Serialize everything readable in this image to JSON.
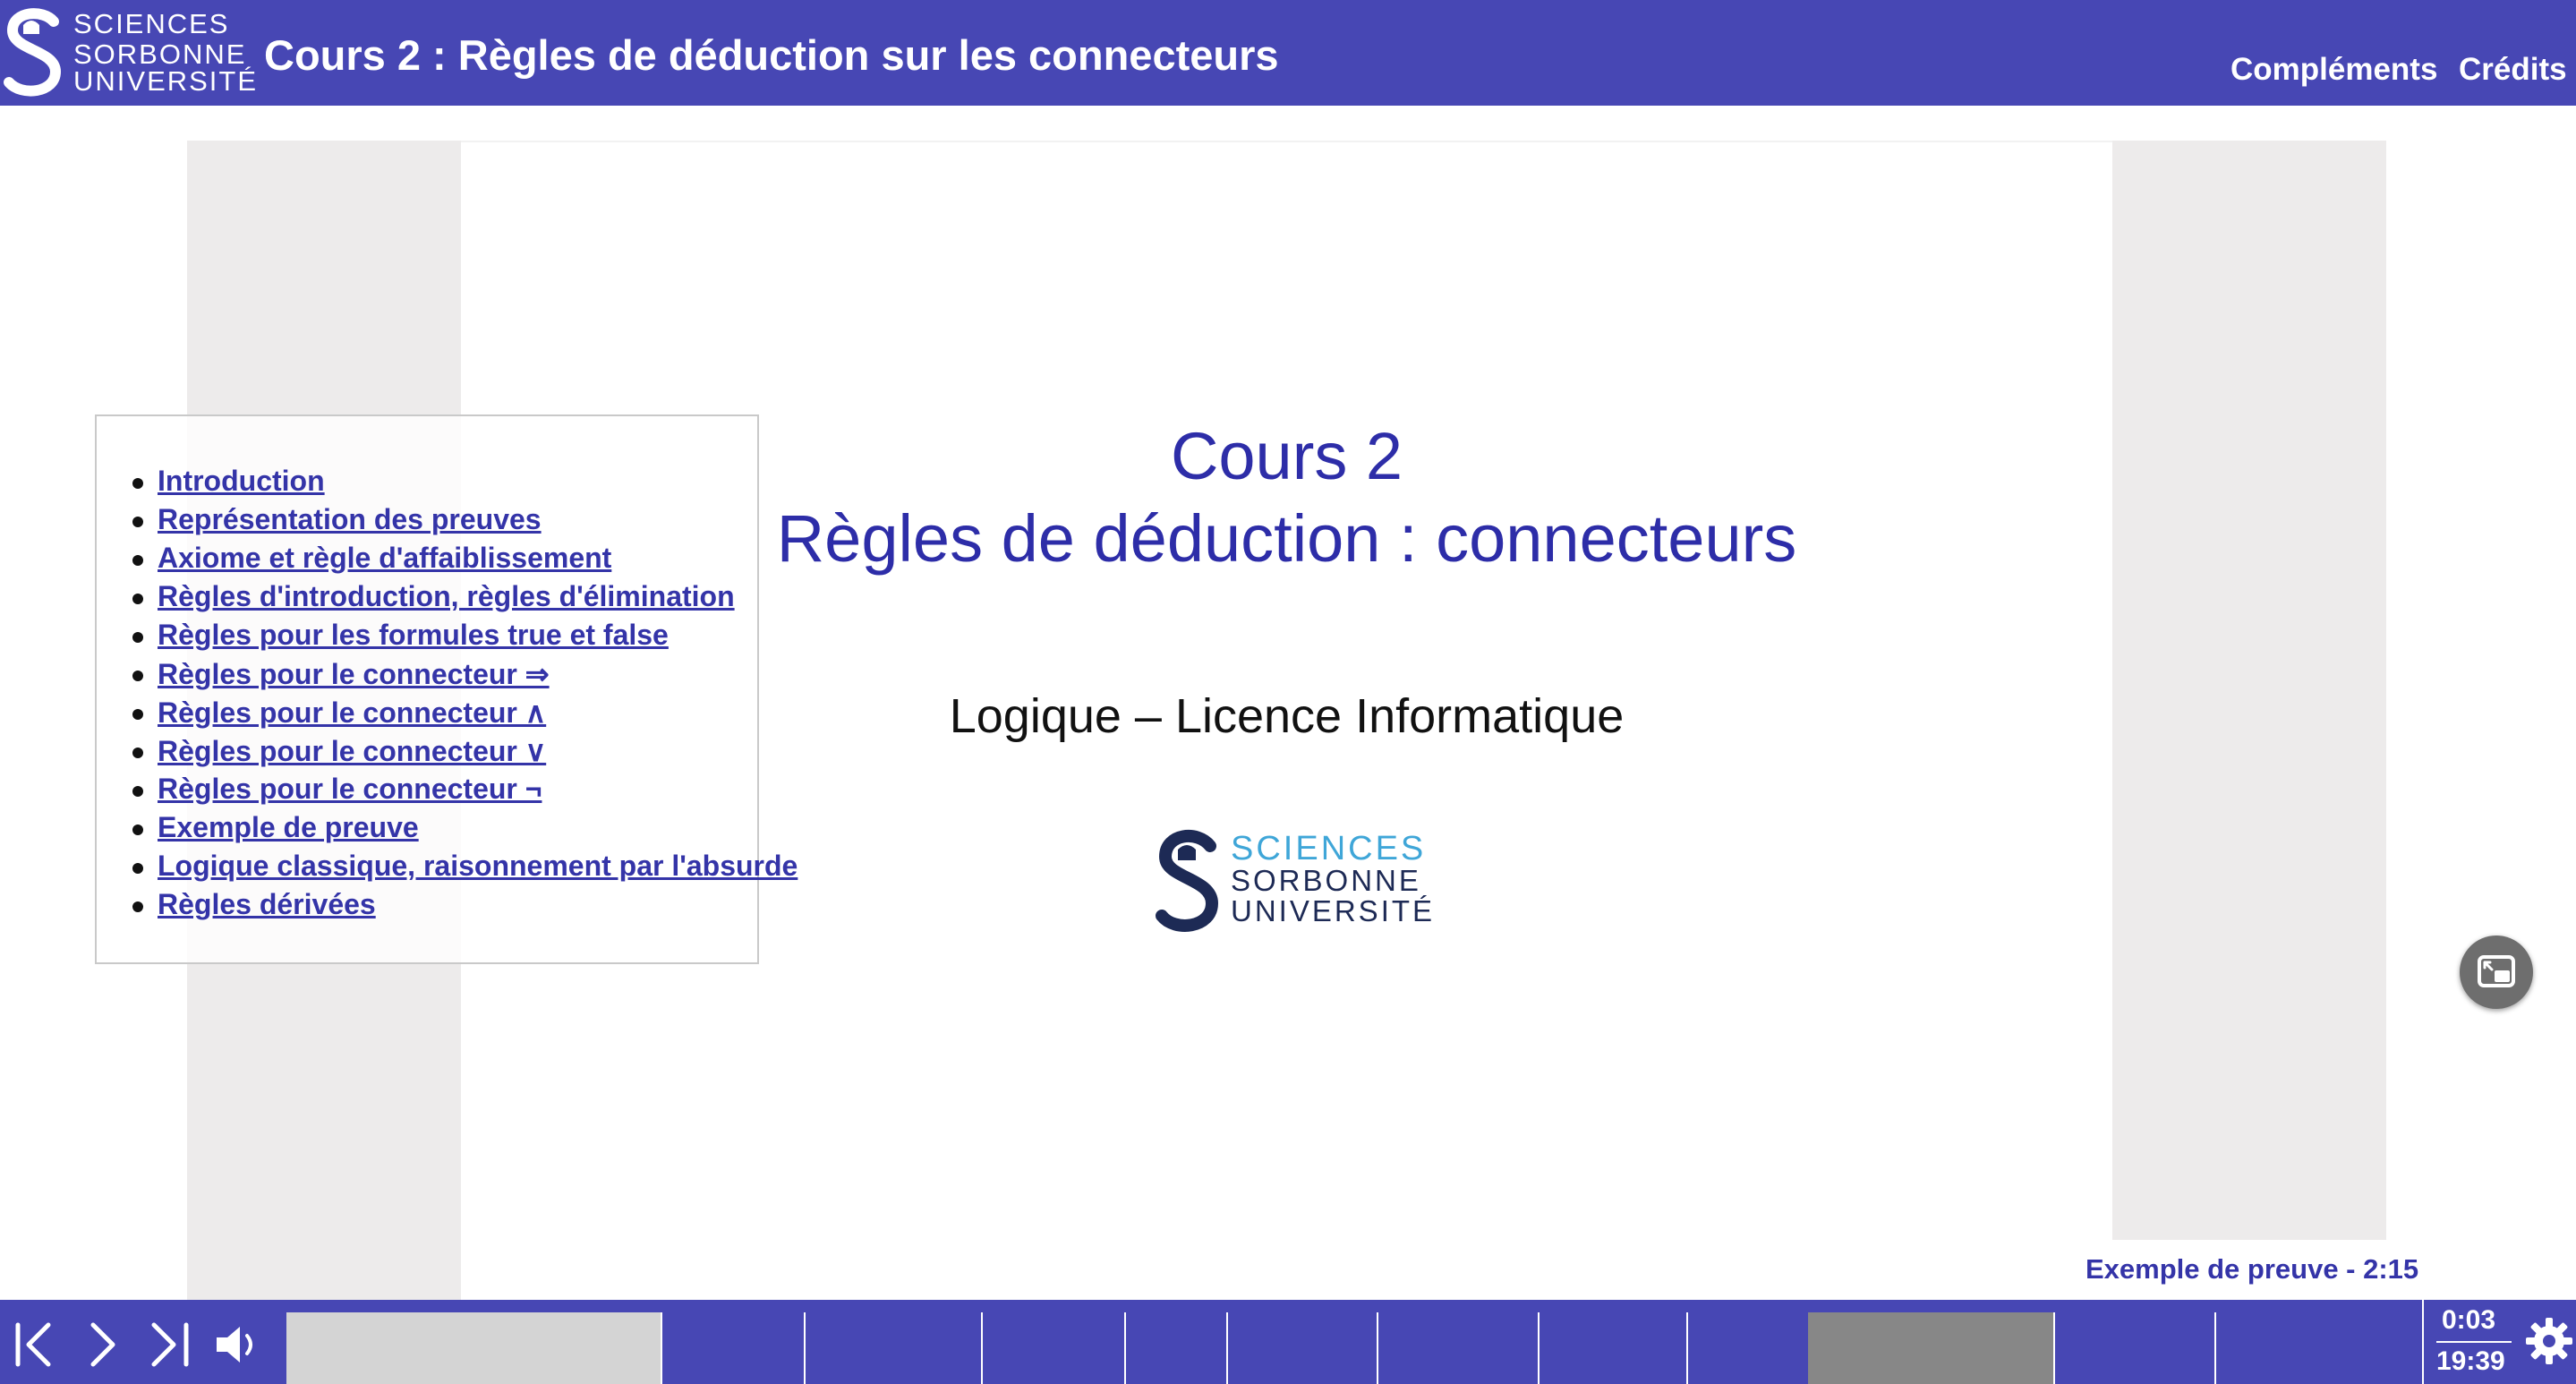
{
  "header": {
    "logo": {
      "line1": "SCIENCES",
      "line2": "SORBONNE",
      "line3": "UNIVERSITÉ"
    },
    "title": "Cours 2 : Règles de déduction sur les connecteurs",
    "nav": {
      "complements": "Compléments",
      "credits": "Crédits"
    }
  },
  "slide": {
    "title_line1": "Cours 2",
    "title_line2": "Règles de déduction : connecteurs",
    "subtitle": "Logique – Licence Informatique",
    "logo": {
      "line1": "SCIENCES",
      "line2": "SORBONNE",
      "line3": "UNIVERSITÉ"
    }
  },
  "toc": [
    "Introduction",
    "Représentation des preuves",
    "Axiome et règle d'affaiblissement",
    "Règles d'introduction, règles d'élimination",
    "Règles pour les formules true et false",
    "Règles pour le connecteur ⇒",
    "Règles pour le connecteur ∧",
    "Règles pour le connecteur ∨",
    "Règles pour le connecteur ¬",
    "Exemple de preuve",
    "Logique classique, raisonnement par l'absurde",
    "Règles dérivées"
  ],
  "chapter_tooltip": "Exemple de preuve - 2:15",
  "player": {
    "current_time": "0:03",
    "total_time": "19:39",
    "colors": {
      "bar": "#4747b4",
      "played": "#d4d4d4",
      "hover": "#878787"
    },
    "icons": [
      "skip-start-icon",
      "next-icon",
      "skip-end-icon",
      "volume-icon",
      "settings-gear-icon",
      "picture-in-picture-icon"
    ]
  }
}
